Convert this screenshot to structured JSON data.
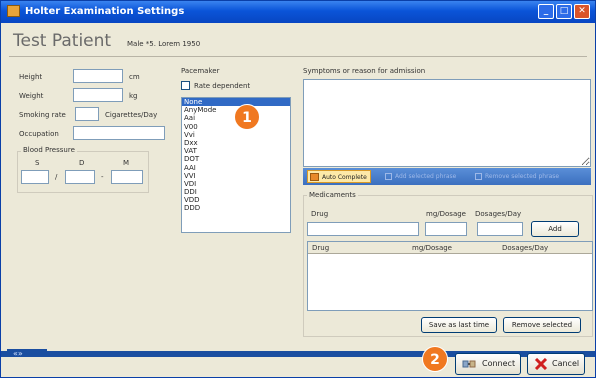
{
  "window": {
    "title": "Holter Examination Settings",
    "min_label": "_",
    "max_label": "□",
    "close_label": "✕"
  },
  "patient": {
    "name": "Test Patient",
    "info": "Male *5. Lorem 1950"
  },
  "form": {
    "height": {
      "label": "Height",
      "unit": "cm",
      "value": ""
    },
    "weight": {
      "label": "Weight",
      "unit": "kg",
      "value": ""
    },
    "smoking": {
      "label": "Smoking rate",
      "unit": "Cigarettes/Day",
      "value": ""
    },
    "occupation": {
      "label": "Occupation",
      "value": ""
    },
    "bp": {
      "title": "Blood Pressure",
      "s": "S",
      "d": "D",
      "m": "M",
      "sep1": "/",
      "sep2": "-"
    }
  },
  "pacemaker": {
    "title": "Pacemaker",
    "rate_dependent": "Rate dependent",
    "rate_dependent_checked": false,
    "modes": [
      "None",
      "AnyMode",
      "Aai",
      "V00",
      "Vvi",
      "Dxx",
      "VAT",
      "DOT",
      "AAI",
      "VVI",
      "VDI",
      "DDI",
      "VDD",
      "DDD"
    ],
    "selected": "None"
  },
  "symptoms": {
    "title": "Symptoms or reason for admission",
    "value": ""
  },
  "actions": {
    "auto_complete": "Auto Complete",
    "add_selected": "Add selected phrase",
    "remove_selected": "Remove selected phrase"
  },
  "medications": {
    "title": "Medicaments",
    "drug_label": "Drug",
    "dosage_label": "mg/Dosage",
    "per_day_label": "Dosages/Day",
    "add_button": "Add",
    "columns": [
      "Drug",
      "mg/Dosage",
      "Dosages/Day"
    ],
    "rows": [],
    "save_button": "Save as last time",
    "remove_button": "Remove selected"
  },
  "footer": {
    "status": "«»",
    "connect": "Connect",
    "cancel": "Cancel"
  },
  "badges": {
    "one": "1",
    "two": "2"
  }
}
